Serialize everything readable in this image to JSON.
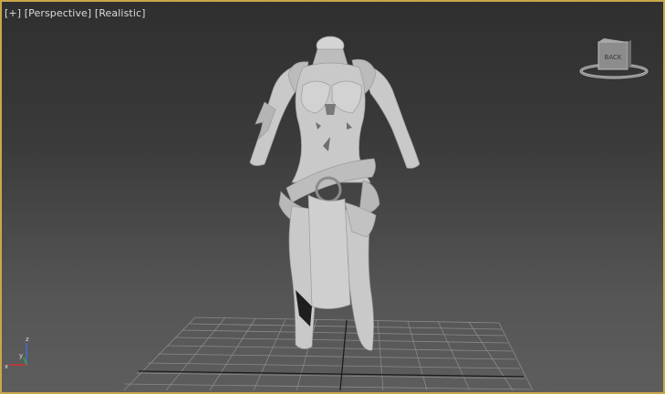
{
  "viewport": {
    "menu_plus": "[+]",
    "view_name": "[Perspective]",
    "shading_mode": "[Realistic]",
    "border_color": "#c9a84a"
  },
  "viewcube": {
    "face_label": "BACK",
    "icon": "viewcube-icon"
  },
  "axis_tripod": {
    "labels": [
      "z",
      "x",
      "y"
    ],
    "colors": {
      "x": "#d23232",
      "y": "#3ca03c",
      "z": "#3b6fd6"
    }
  },
  "scene": {
    "object": "armored-female-body-mesh",
    "grid": "home-grid"
  }
}
